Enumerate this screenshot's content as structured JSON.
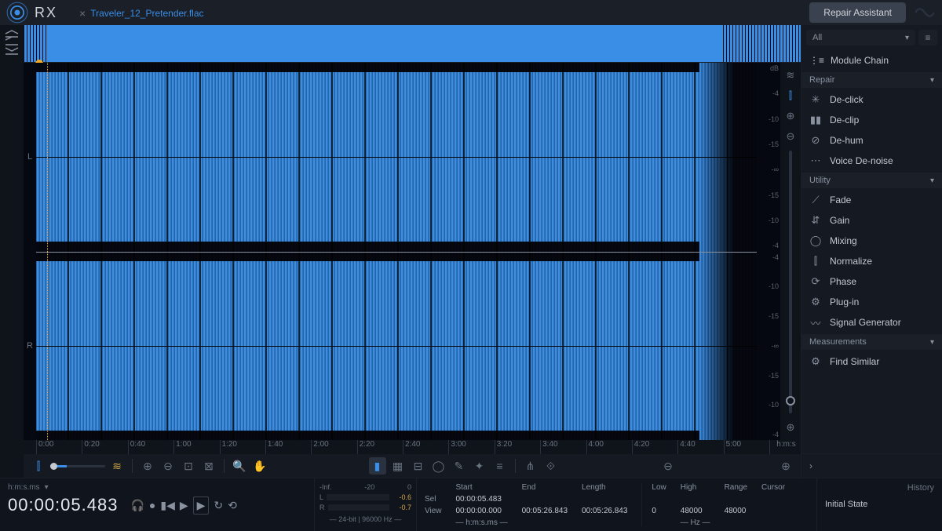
{
  "app": {
    "name": "RX",
    "repair_button": "Repair Assistant"
  },
  "tab": {
    "filename": "Traveler_12_Pretender.flac"
  },
  "channels": {
    "left": "L",
    "right": "R"
  },
  "db_scale": {
    "header": "dB",
    "values": [
      "-4",
      "-10",
      "-15",
      "-∞",
      "-15",
      "-10",
      "-4"
    ]
  },
  "timeline": {
    "marks": [
      "0:00",
      "0:20",
      "0:40",
      "1:00",
      "1:20",
      "1:40",
      "2:00",
      "2:20",
      "2:40",
      "3:00",
      "3:20",
      "3:40",
      "4:00",
      "4:20",
      "4:40",
      "5:00"
    ],
    "unit": "h:m:s"
  },
  "sidebar": {
    "filter": "All",
    "module_chain": "Module Chain",
    "categories": {
      "repair": "Repair",
      "utility": "Utility",
      "measurements": "Measurements"
    },
    "repair_items": [
      {
        "label": "De-click",
        "icon": "✳"
      },
      {
        "label": "De-clip",
        "icon": "▮▮"
      },
      {
        "label": "De-hum",
        "icon": "⊘"
      },
      {
        "label": "Voice De-noise",
        "icon": "⋯"
      }
    ],
    "utility_items": [
      {
        "label": "Fade",
        "icon": "⟋"
      },
      {
        "label": "Gain",
        "icon": "⇵"
      },
      {
        "label": "Mixing",
        "icon": "◯"
      },
      {
        "label": "Normalize",
        "icon": "⫿"
      },
      {
        "label": "Phase",
        "icon": "⟳"
      },
      {
        "label": "Plug-in",
        "icon": "⚙"
      },
      {
        "label": "Signal Generator",
        "icon": "〰"
      }
    ],
    "find_similar": "Find Similar"
  },
  "transport": {
    "format_label": "h:m:s.ms",
    "time": "00:00:05.483",
    "audio_format": "24-bit | 96000 Hz"
  },
  "meters": {
    "scale": [
      "-Inf.",
      "-20",
      "0"
    ],
    "L": {
      "label": "L",
      "peak": "-0.6"
    },
    "R": {
      "label": "R",
      "peak": "-0.7"
    }
  },
  "info": {
    "headers": {
      "start": "Start",
      "end": "End",
      "length": "Length",
      "low": "Low",
      "high": "High",
      "range": "Range",
      "cursor": "Cursor"
    },
    "rows": {
      "sel": "Sel",
      "view": "View"
    },
    "sel_start": "00:00:05.483",
    "view_start": "00:00:00.000",
    "view_end": "00:05:26.843",
    "view_length": "00:05:26.843",
    "low": "0",
    "high": "48000",
    "range": "48000",
    "time_unit": "h:m:s.ms",
    "freq_unit": "Hz"
  },
  "history": {
    "title": "History",
    "entry": "Initial State"
  }
}
